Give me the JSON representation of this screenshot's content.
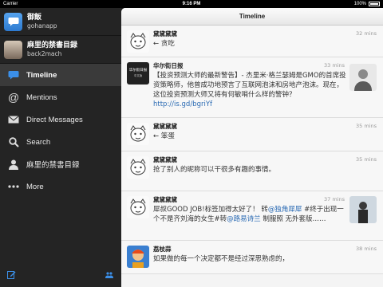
{
  "status_bar": {
    "carrier": "Carrier",
    "time": "9:16 PM",
    "battery": "100%"
  },
  "sidebar": {
    "accounts": [
      {
        "name": "御飯",
        "handle": "gohanapp"
      },
      {
        "name": "麻里的禁書目録",
        "handle": "back2mach"
      }
    ],
    "nav": [
      {
        "label": "Timeline",
        "icon": "speech-bubble-icon",
        "active": true
      },
      {
        "label": "Mentions",
        "icon": "at-sign-icon"
      },
      {
        "label": "Direct Messages",
        "icon": "envelope-icon"
      },
      {
        "label": "Search",
        "icon": "search-icon"
      },
      {
        "label": "麻里的禁書目録",
        "icon": "person-icon"
      },
      {
        "label": "More",
        "icon": "more-dots-icon"
      }
    ],
    "bottom": {
      "compose": "compose-icon",
      "people": "people-icon"
    }
  },
  "main": {
    "title": "Timeline",
    "tweets": [
      {
        "name": "黛黛黛黛",
        "time": "32 mins",
        "body": "← 贪吃"
      },
      {
        "name": "华尔街日报",
        "time": "33 mins",
        "avatar_text": "华尔街日报",
        "avatar_sub": "中文版",
        "body": "【投资预测大师的最新警告】- 杰里米·格兰瑟姆是GMO的首席投资策略师，他曾成功地预言了互联网泡沫和房地产泡沫。现在，这位投资预测大师又将有何敏哨什么样的警钟？",
        "link": "http://is.gd/bgriYf"
      },
      {
        "name": "黛黛黛黛",
        "time": "35 mins",
        "body": "← 笨蛋"
      },
      {
        "name": "黛黛黛黛",
        "time": "35 mins",
        "body": "抢了别人的昵称可以干很多有趣的事情。"
      },
      {
        "name": "黛黛黛黛",
        "time": "37 mins",
        "body_parts": [
          "犀叔GOOD JOB!标签加得太好了！  转",
          "@独角犀犀",
          " #终于出现一个不是齐刘海的女生#转",
          "@路易诗兰",
          " 制服照 无外套版……"
        ]
      },
      {
        "name": "荔枝蒜",
        "time": "38 mins",
        "body": "如果做的每一个决定都不是经过深思熟虑的，"
      }
    ]
  }
}
